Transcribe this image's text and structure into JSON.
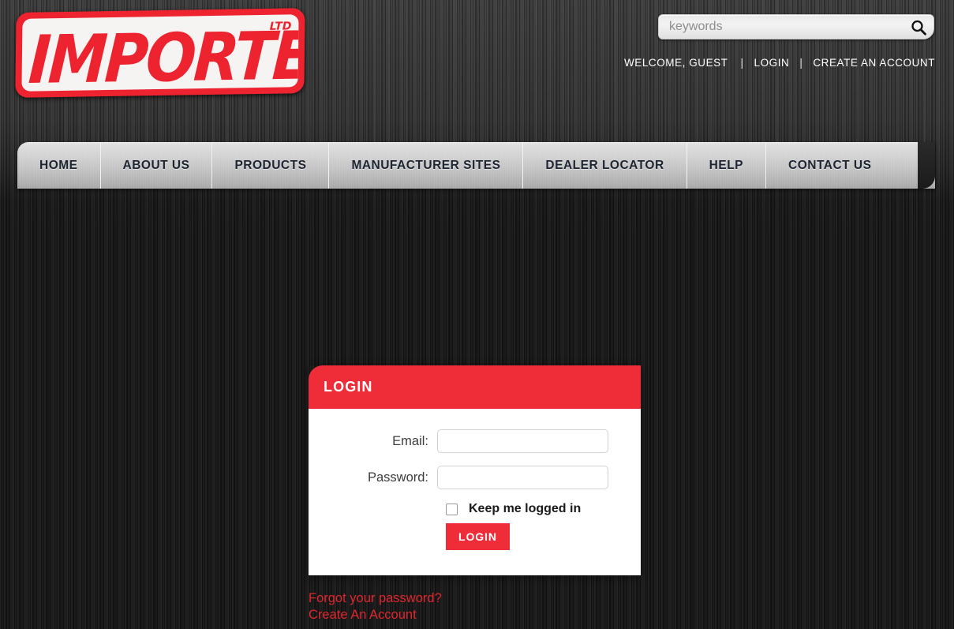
{
  "brand": {
    "logo_text": "IMPORTEL",
    "logo_suffix": "LTD",
    "accent_red": "#EE2D38",
    "logo_red": "#ED2430"
  },
  "search": {
    "placeholder": "keywords",
    "value": "",
    "icon": "search-icon"
  },
  "account_bar": {
    "welcome": "WELCOME, GUEST",
    "separator": "|",
    "login": "LOGIN",
    "create_account": "CREATE AN ACCOUNT"
  },
  "nav": {
    "items": [
      {
        "label": "HOME"
      },
      {
        "label": "ABOUT US"
      },
      {
        "label": "PRODUCTS"
      },
      {
        "label": "MANUFACTURER SITES"
      },
      {
        "label": "DEALER LOCATOR"
      },
      {
        "label": "HELP"
      },
      {
        "label": "CONTACT US"
      }
    ]
  },
  "login_panel": {
    "title": "LOGIN",
    "email_label": "Email:",
    "email_value": "",
    "password_label": "Password:",
    "password_value": "",
    "keep_logged_in_label": "Keep me logged in",
    "keep_logged_in_checked": false,
    "submit_label": "LOGIN",
    "forgot_password_link": "Forgot your password?",
    "create_account_link": "Create An Account"
  }
}
